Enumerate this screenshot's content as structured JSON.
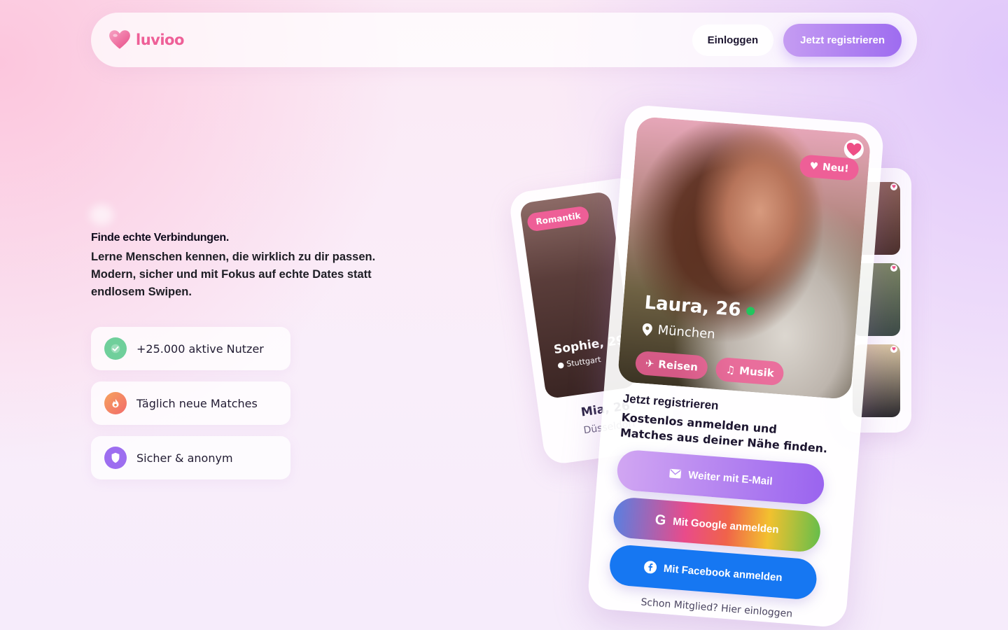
{
  "brand": {
    "name": "luvioo",
    "color": "#ee5f97"
  },
  "nav": {
    "login_label": "Einloggen",
    "register_label": "Jetzt registrieren"
  },
  "hero": {
    "title": "Finde echte Verbindungen.",
    "description": "Lerne Menschen kennen, die wirklich zu dir passen. Modern, sicher und mit Fokus auf echte Dates statt endlosem Swipen."
  },
  "features": [
    {
      "label": "+25.000 aktive Nutzer",
      "icon": "verified-check-icon",
      "color": "#5fc48e"
    },
    {
      "label": "Täglich neue Matches",
      "icon": "flame-icon",
      "color": "#f5895a"
    },
    {
      "label": "Sicher & anonym",
      "icon": "shield-icon",
      "color": "#9a6cf0"
    }
  ],
  "cards": {
    "left": {
      "tag": "Romantik",
      "name": "Sophie, 29",
      "city": "Stuttgart",
      "second_name": "Mia, 26",
      "second_city": "Düsseldorf"
    },
    "main": {
      "badge": "Neu!",
      "name": "Laura, 26",
      "city": "München",
      "interests": [
        "Reisen",
        "Musik"
      ],
      "register_title": "Jetzt registrieren",
      "register_subtitle": "Kostenlos anmelden und Matches aus deiner Nähe finden.",
      "email_button": "Weiter mit E-Mail",
      "google_button": "Mit Google anmelden",
      "facebook_button": "Mit Facebook anmelden",
      "member_link": "Schon Mitglied? Hier einloggen"
    }
  }
}
